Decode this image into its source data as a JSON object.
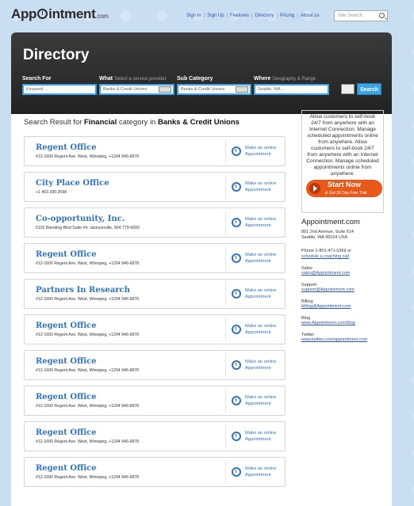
{
  "brand": {
    "logo_pre": "App",
    "logo_post": "intment",
    "logo_suffix": ".com"
  },
  "nav": {
    "signin": "Sign In",
    "signup": "Sign Up",
    "features": "Features",
    "directory": "Directory",
    "pricing": "Pricing",
    "about": "About us"
  },
  "site_search": {
    "placeholder": "Site Search"
  },
  "page": {
    "title": "Directory"
  },
  "filters": {
    "search_for_label": "Search For",
    "keyword_value": "Keyword ...",
    "what_label": "What",
    "what_hint": "Select a service provider",
    "what_value": "Banks & Credit Unions",
    "subcategory_label": "Sub Category",
    "subcategory_value": "Banks & Credit Unions",
    "where_label": "Where",
    "where_hint": "Geography & Range",
    "where_value": "Seattle, WA ...",
    "search_button": "Search"
  },
  "results_head": {
    "prefix": "Search Result for",
    "category": "Financial",
    "mid": "category in",
    "subcategory": "Banks & Credit Unions"
  },
  "booking_label_1": "Make an online",
  "booking_label_2": "Appointment",
  "results": [
    {
      "name": "Regent Office",
      "address": "#12-1600 Regent Ave. West, Winnipeg, +1204 946-6878"
    },
    {
      "name": "City Place Office",
      "address": "+1 403.390.3598"
    },
    {
      "name": "Co-opportunity, Inc.",
      "address": "5102 Blending Blvd Suite #4, Jacksonville, 904 779-6000"
    },
    {
      "name": "Regent Office",
      "address": "#12-1600 Regent Ave. West, Winnipeg, +1204 946-6878"
    },
    {
      "name": "Partners In Research",
      "address": "#12-1600 Regent Ave. West, Winnipeg, +1204 946-6878"
    },
    {
      "name": "Regent Office",
      "address": "#12-1600 Regent Ave. West, Winnipeg, +1204 946-6878"
    },
    {
      "name": "Regent Office",
      "address": "#12-1600 Regent Ave. West, Winnipeg, +1204 946-6878"
    },
    {
      "name": "Regent Office",
      "address": "#12-1600 Regent Ave. West, Winnipeg, +1204 946-6878"
    },
    {
      "name": "Regent Office",
      "address": "#12-1600 Regent Ave. West, Winnipeg, +1204 946-6878"
    },
    {
      "name": "Regent Office",
      "address": "#12-1600 Regent Ave. West, Winnipeg, +1204 946-6878"
    }
  ],
  "sidebar": {
    "promo": "Allow customers to self-book 24/7 from anywhere with an Internet Connection. Manage scheduled appointments online from anywhere. Allow customers to self-book 24/7 from anywhere with an Internet Connection. Manage scheduled appointments online from anywhere.",
    "start_now": "Start Now",
    "start_sub": "& Get 30 Day Free Trial",
    "company": "Appointment.com",
    "address1": "801 2nd Avenue, Suite 614",
    "address2": "Seattle, WA 98104 USA",
    "phone": "Phone 1-801-471-0369 or",
    "coaching_link": "schedule a coaching call",
    "sales_label": "Sales",
    "sales_email": "sales@Appointment.com",
    "support_label": "Support",
    "support_email": "support@Appointment.com",
    "billing_label": "Billing",
    "billing_email": "billing@Appointment.com",
    "blog_label": "Blog",
    "blog_link": "www.Appointment.com/blog",
    "twitter_label": "Twitter",
    "twitter_link": "www.twitter.com/appointment.com"
  }
}
